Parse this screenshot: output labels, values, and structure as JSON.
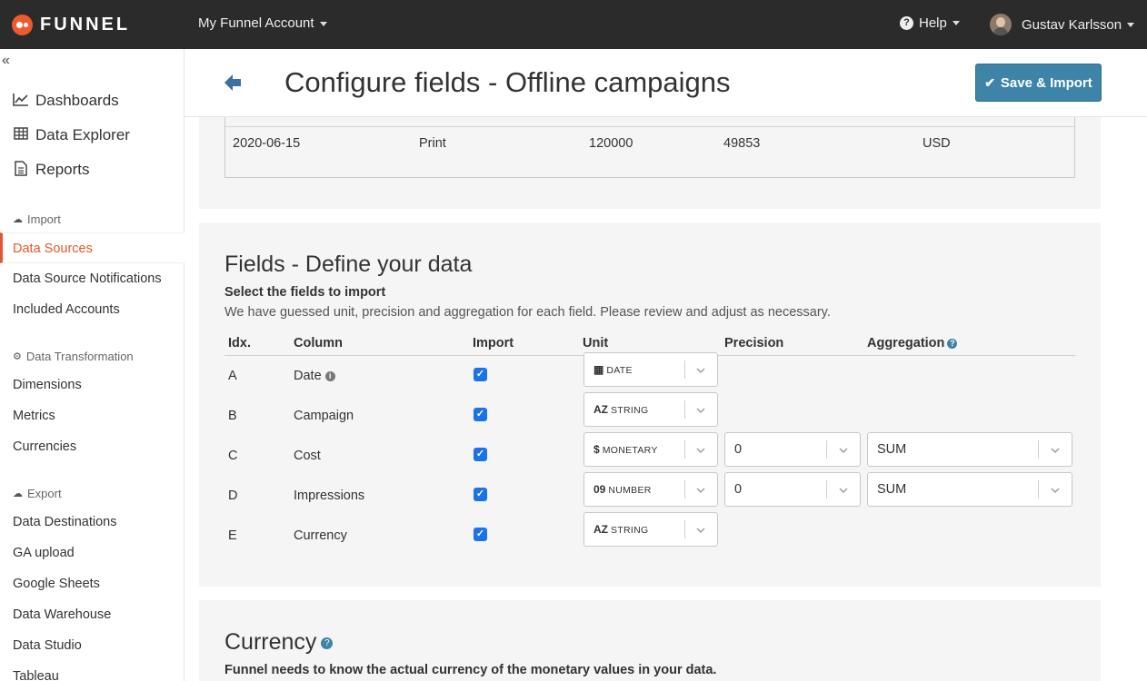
{
  "app": {
    "name": "FUNNEL",
    "account": "My Funnel Account",
    "help": "Help",
    "user": "Gustav Karlsson"
  },
  "sidebar": {
    "main": [
      {
        "label": "Dashboards",
        "icon": "line-chart-icon"
      },
      {
        "label": "Data Explorer",
        "icon": "table-icon"
      },
      {
        "label": "Reports",
        "icon": "document-icon"
      }
    ],
    "import_title": "Import",
    "import_items": [
      "Data Sources",
      "Data Source Notifications",
      "Included Accounts"
    ],
    "transform_title": "Data Transformation",
    "transform_items": [
      "Dimensions",
      "Metrics",
      "Currencies"
    ],
    "export_title": "Export",
    "export_items": [
      "Data Destinations",
      "GA upload",
      "Google Sheets",
      "Data Warehouse",
      "Data Studio",
      "Tableau"
    ]
  },
  "header": {
    "title": "Configure fields - Offline campaigns",
    "save_label": "Save & Import"
  },
  "preview_row": [
    "2020-06-15",
    "Print",
    "120000",
    "49853",
    "USD"
  ],
  "fields": {
    "title": "Fields - Define your data",
    "subtitle": "Select the fields to import",
    "description": "We have guessed unit, precision and aggregation for each field. Please review and adjust as necessary.",
    "columns": [
      "Idx.",
      "Column",
      "Import",
      "Unit",
      "Precision",
      "Aggregation"
    ],
    "rows": [
      {
        "idx": "A",
        "column": "Date",
        "import": true,
        "unit_icon": "▦",
        "unit": "DATE",
        "unit_color": "green",
        "precision": "",
        "aggregation": ""
      },
      {
        "idx": "B",
        "column": "Campaign",
        "import": true,
        "unit_icon": "AZ",
        "unit": "STRING",
        "unit_color": "green",
        "precision": "",
        "aggregation": ""
      },
      {
        "idx": "C",
        "column": "Cost",
        "import": true,
        "unit_icon": "$",
        "unit": "MONETARY",
        "unit_color": "blue",
        "precision": "0",
        "aggregation": "SUM"
      },
      {
        "idx": "D",
        "column": "Impressions",
        "import": true,
        "unit_icon": "09",
        "unit": "NUMBER",
        "unit_color": "blue",
        "precision": "0",
        "aggregation": "SUM"
      },
      {
        "idx": "E",
        "column": "Currency",
        "import": true,
        "unit_icon": "AZ",
        "unit": "STRING",
        "unit_color": "green",
        "precision": "",
        "aggregation": ""
      }
    ]
  },
  "currency": {
    "title": "Currency",
    "description": "Funnel needs to know the actual currency of the monetary values in your data."
  }
}
